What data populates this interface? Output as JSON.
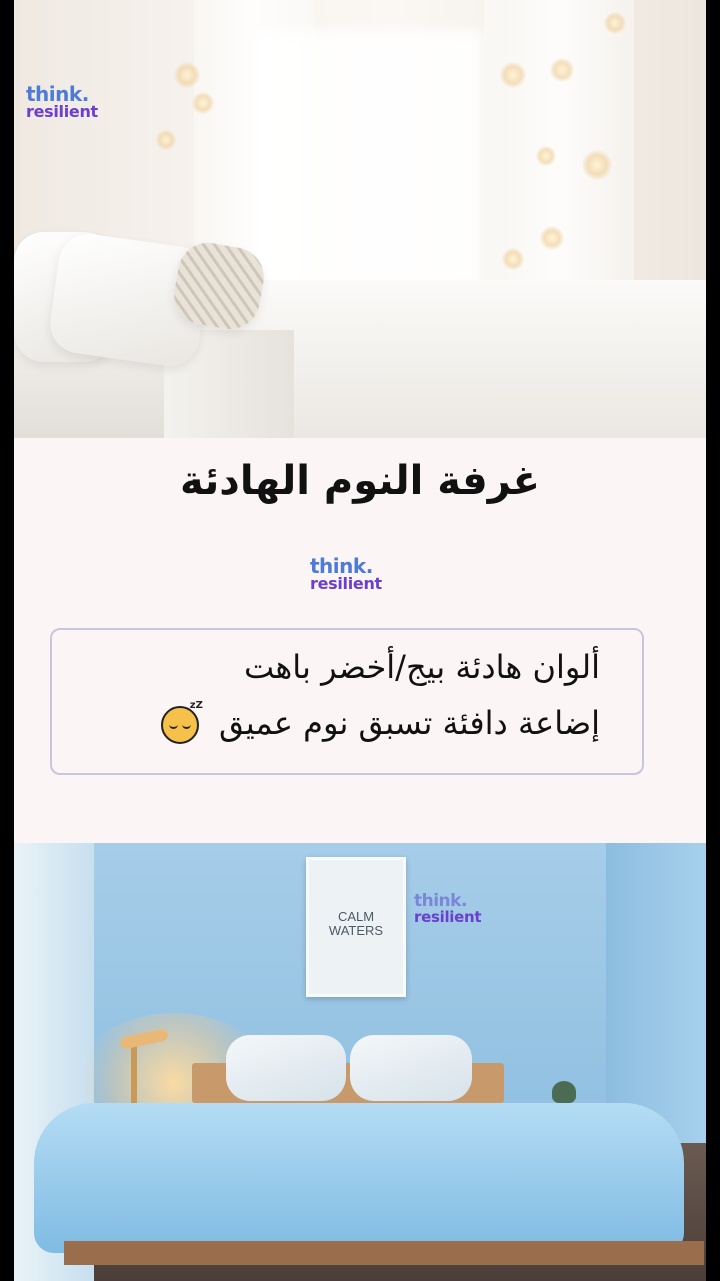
{
  "brand": {
    "line1": "think.",
    "line2": "resilient",
    "colors": {
      "line1": "#4d7bd6",
      "line2": "#6b3fd0"
    }
  },
  "title": "غرفة النوم الهادئة",
  "tips": {
    "line1": "ألوان هادئة بيج/أخضر باهت",
    "line2": "إضاعة دافئة تسبق نوم عميق",
    "line2_icon": "sleeping-face-emoji",
    "zz": "zZ"
  },
  "poster": {
    "text_line1": "CALM",
    "text_line2": "WATERS"
  },
  "colors": {
    "background": "#fbf6f5",
    "card_border": "#c7c6df",
    "title": "#111111"
  }
}
